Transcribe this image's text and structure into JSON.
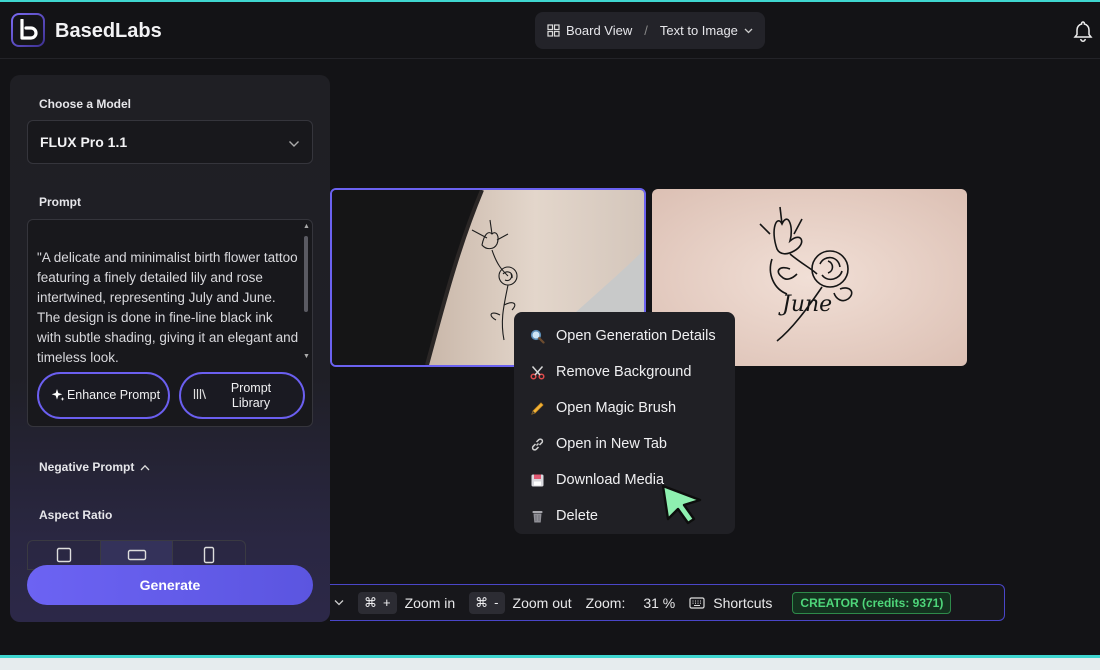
{
  "header": {
    "brand": "BasedLabs",
    "breadcrumb": {
      "view": "Board View",
      "separator": "/",
      "mode": "Text to Image"
    }
  },
  "sidebar": {
    "model_label": "Choose a Model",
    "model_value": "FLUX Pro 1.1",
    "prompt_label": "Prompt",
    "prompt_text": "\"A delicate and minimalist birth flower tattoo featuring a finely detailed lily and rose intertwined, representing July and June. The design is done in fine-line black ink with subtle shading, giving it an elegant and timeless look.",
    "enhance_label": "Enhance Prompt",
    "library_label": "Prompt Library",
    "negative_label": "Negative Prompt",
    "aspect_label": "Aspect Ratio",
    "generate_label": "Generate"
  },
  "context_menu": {
    "items": [
      {
        "label": "Open Generation Details",
        "icon": "magnifier-icon"
      },
      {
        "label": "Remove Background",
        "icon": "scissors-icon"
      },
      {
        "label": "Open Magic Brush",
        "icon": "pencil-icon"
      },
      {
        "label": "Open in New Tab",
        "icon": "link-icon"
      },
      {
        "label": "Download Media",
        "icon": "floppy-disk-icon"
      },
      {
        "label": "Delete",
        "icon": "trash-icon"
      }
    ]
  },
  "toolbar": {
    "zoom_in_key": "⌘",
    "zoom_in_plus": "+",
    "zoom_in_label": "Zoom in",
    "zoom_out_key": "⌘",
    "zoom_out_minus": "-",
    "zoom_out_label": "Zoom out",
    "zoom_label": "Zoom:",
    "zoom_value": "31 %",
    "shortcuts_label": "Shortcuts",
    "plan_badge": "CREATOR (credits: 9371)"
  },
  "images": {
    "tattoo_caption": "June"
  },
  "colors": {
    "accent": "#6b62f0",
    "success": "#4ed67a",
    "cursor": "#8ef0b0"
  }
}
